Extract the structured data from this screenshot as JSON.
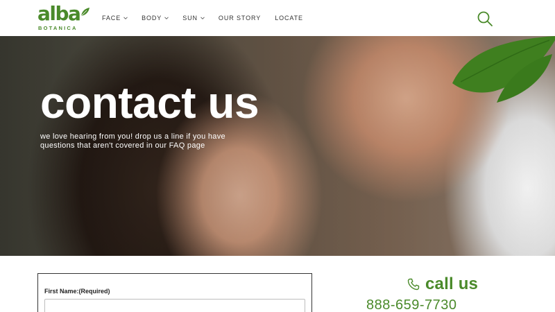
{
  "brand": {
    "wordmark": "alba",
    "subline": "BOTANICA",
    "color": "#4a8a2a"
  },
  "nav": {
    "items": [
      {
        "label": "FACE",
        "has_dropdown": true
      },
      {
        "label": "BODY",
        "has_dropdown": true
      },
      {
        "label": "SUN",
        "has_dropdown": true
      },
      {
        "label": "OUR STORY",
        "has_dropdown": false
      },
      {
        "label": "LOCATE",
        "has_dropdown": false
      }
    ],
    "search_icon": "search-icon"
  },
  "hero": {
    "title": "contact us",
    "subtitle": "we love hearing from you! drop us a line if you have questions that aren't covered in our FAQ page"
  },
  "form": {
    "first_name_label": "First Name:(Required)",
    "first_name_value": ""
  },
  "call": {
    "title": "call us",
    "icon": "phone-icon",
    "number": "888-659-7730"
  }
}
